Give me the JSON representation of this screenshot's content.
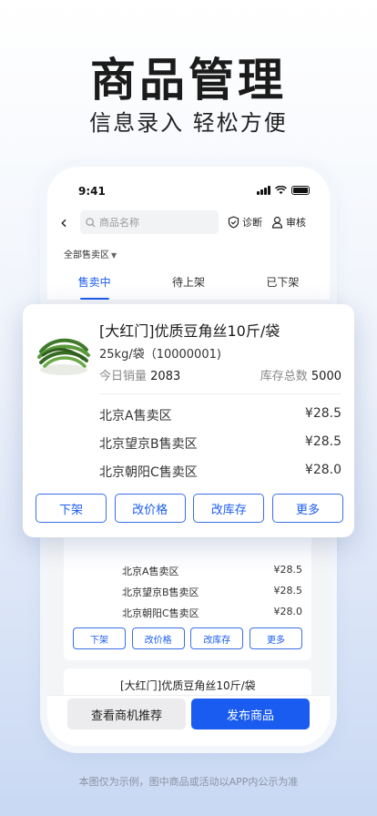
{
  "hero": {
    "title": "商品管理",
    "subtitle": "信息录入 轻松方便"
  },
  "status_bar": {
    "time": "9:41"
  },
  "topbar": {
    "search_placeholder": "商品名称",
    "diagnose_label": "诊断",
    "review_label": "审核"
  },
  "filter": {
    "area_label": "全部售卖区"
  },
  "tabs": [
    {
      "label": "售卖中",
      "active": true
    },
    {
      "label": "待上架",
      "active": false
    },
    {
      "label": "已下架",
      "active": false
    }
  ],
  "popup_card": {
    "title": "[大红门]优质豆角丝10斤/袋",
    "spec": "25kg/袋（10000001)",
    "sales_label": "今日销量",
    "sales_value": "2083",
    "stock_label": "库存总数",
    "stock_value": "5000",
    "regions": [
      {
        "name": "北京A售卖区",
        "price": "¥28.5"
      },
      {
        "name": "北京望京B售卖区",
        "price": "¥28.5"
      },
      {
        "name": "北京朝阳C售卖区",
        "price": "¥28.0"
      }
    ],
    "buttons": [
      "下架",
      "改价格",
      "改库存",
      "更多"
    ]
  },
  "background_card": {
    "regions": [
      {
        "name": "北京A售卖区",
        "price": "¥28.5"
      },
      {
        "name": "北京望京B售卖区",
        "price": "¥28.5"
      },
      {
        "name": "北京朝阳C售卖区",
        "price": "¥28.0"
      }
    ],
    "buttons": [
      "下架",
      "改价格",
      "改库存",
      "更多"
    ]
  },
  "next_card": {
    "title": "[大红门]优质豆角丝10斤/袋"
  },
  "bottom_bar": {
    "secondary_label": "查看商机推荐",
    "primary_label": "发布商品"
  },
  "disclaimer": "本图仅为示例，图中商品或活动以APP内公示为准",
  "colors": {
    "accent": "#1a5cf0"
  }
}
